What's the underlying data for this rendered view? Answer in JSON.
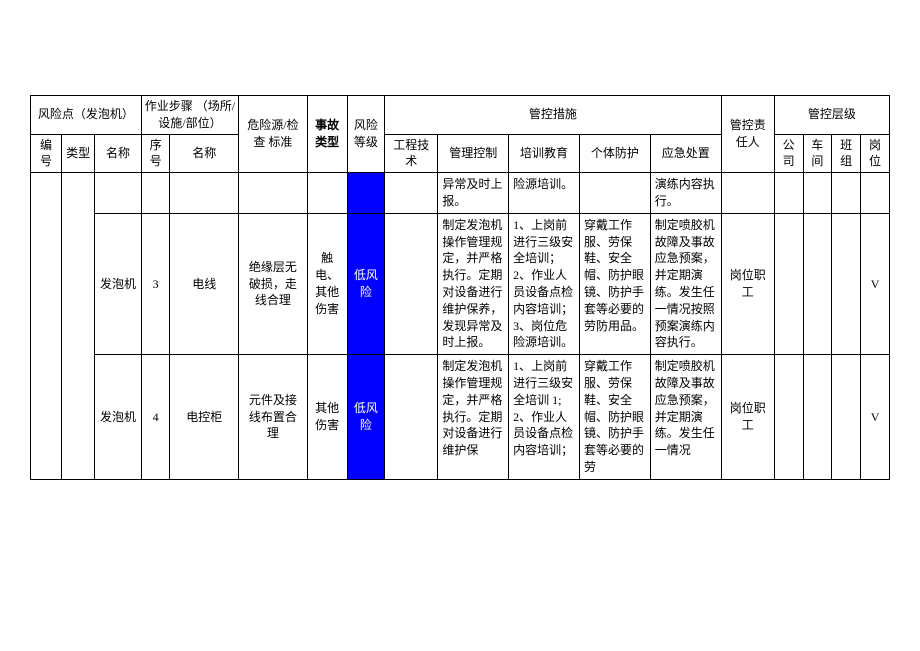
{
  "header": {
    "risk_point_group": "风险点（发泡机）",
    "step_group": "作业步骤\n（场所/设施/部位）",
    "hazard": "危险源/检查\n标准",
    "accident_type": "事故类型",
    "risk_level": "风险等级",
    "control_measures": "管控措施",
    "responsible": "管控责任人",
    "control_level": "管控层级",
    "num": "编号",
    "type": "类型",
    "name": "名称",
    "seq": "序号",
    "step_name": "名称",
    "eng": "工程技术",
    "mgmt": "管理控制",
    "train": "培训教育",
    "ppe": "个体防护",
    "emer": "应急处置",
    "company": "公司",
    "workshop": "车间",
    "team": "班组",
    "position": "岗位"
  },
  "rows": [
    {
      "mgmt": "异常及时上报。",
      "train": "险源培训。",
      "emer": "演练内容执行。"
    },
    {
      "name": "发泡机",
      "seq": "3",
      "step_name": "电线",
      "hazard": "绝缘层无破损，走线合理",
      "accident": "触电、其他伤害",
      "risk": "低风险",
      "mgmt": "制定发泡机操作管理规定，并严格执行。定期对设备进行维护保养，发现异常及时上报。",
      "train": "1、上岗前进行三级安全培训；2、作业人员设备点检内容培训；3、岗位危险源培训。",
      "ppe": "穿戴工作服、劳保鞋、安全帽、防护眼镜、防护手套等必要的劳防用品。",
      "emer": "制定喷胶机故障及事故应急预案，并定期演练。发生任一情况按照预案演练内容执行。",
      "resp": "岗位职工",
      "pos": "V"
    },
    {
      "name": "发泡机",
      "seq": "4",
      "step_name": "电控柜",
      "hazard": "元件及接线布置合理",
      "accident": "其他伤害",
      "risk": "低风险",
      "mgmt": "制定发泡机操作管理规定，并严格执行。定期对设备进行维护保",
      "train": "1、上岗前进行三级安全培训 1;2、作业人员设备点检内容培训；",
      "ppe": "穿戴工作服、劳保鞋、安全帽、防护眼镜、防护手套等必要的劳",
      "emer": "制定喷胶机故障及事故应急预案，并定期演练。发生任一情况",
      "resp": "岗位职工",
      "pos": "V"
    }
  ]
}
